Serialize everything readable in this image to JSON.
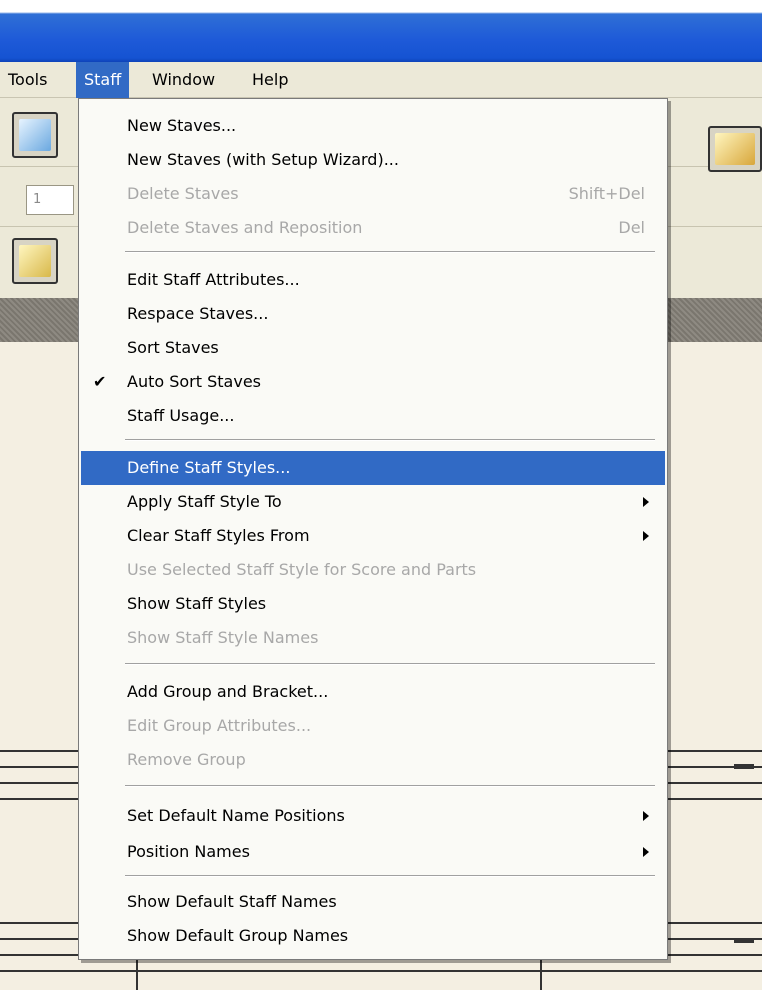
{
  "menubar": {
    "items": [
      {
        "label": "Tools"
      },
      {
        "label": "Staff"
      },
      {
        "label": "Window"
      },
      {
        "label": "Help"
      }
    ],
    "active": "Staff"
  },
  "toolbar": {
    "field_value": "1"
  },
  "staff_menu": {
    "items": [
      {
        "label": "New Staves...",
        "shortcut": "",
        "disabled": false
      },
      {
        "label": "New Staves (with Setup Wizard)...",
        "shortcut": "",
        "disabled": false
      },
      {
        "label": "Delete Staves",
        "shortcut": "Shift+Del",
        "disabled": true
      },
      {
        "label": "Delete Staves and Reposition",
        "shortcut": "Del",
        "disabled": true
      },
      {
        "label": "Edit Staff Attributes...",
        "shortcut": "",
        "disabled": false
      },
      {
        "label": "Respace Staves...",
        "shortcut": "",
        "disabled": false
      },
      {
        "label": "Sort Staves",
        "shortcut": "",
        "disabled": false
      },
      {
        "label": "Auto Sort Staves",
        "shortcut": "",
        "disabled": false,
        "checked": true
      },
      {
        "label": "Staff Usage...",
        "shortcut": "",
        "disabled": false
      },
      {
        "label": "Define Staff Styles...",
        "shortcut": "",
        "disabled": false,
        "highlighted": true
      },
      {
        "label": "Apply Staff Style To",
        "shortcut": "",
        "disabled": false,
        "submenu": true
      },
      {
        "label": "Clear Staff Styles From",
        "shortcut": "",
        "disabled": false,
        "submenu": true
      },
      {
        "label": "Use Selected Staff Style for Score and Parts",
        "shortcut": "",
        "disabled": true
      },
      {
        "label": "Show Staff Styles",
        "shortcut": "",
        "disabled": false
      },
      {
        "label": "Show Staff Style Names",
        "shortcut": "",
        "disabled": true
      },
      {
        "label": "Add Group and Bracket...",
        "shortcut": "",
        "disabled": false
      },
      {
        "label": "Edit Group Attributes...",
        "shortcut": "",
        "disabled": true
      },
      {
        "label": "Remove Group",
        "shortcut": "",
        "disabled": true
      },
      {
        "label": "Set Default Name Positions",
        "shortcut": "",
        "disabled": false,
        "submenu": true
      },
      {
        "label": "Position Names",
        "shortcut": "",
        "disabled": false,
        "submenu": true
      },
      {
        "label": "Show Default Staff Names",
        "shortcut": "",
        "disabled": false
      },
      {
        "label": "Show Default Group Names",
        "shortcut": "",
        "disabled": false
      }
    ]
  },
  "icons": {
    "check": "checkmark-icon",
    "submenu": "submenu-arrow-icon"
  },
  "colors": {
    "highlight": "#316ac5",
    "titlebar": "#1e5ad8",
    "disabled_text": "#a8a8a8"
  }
}
